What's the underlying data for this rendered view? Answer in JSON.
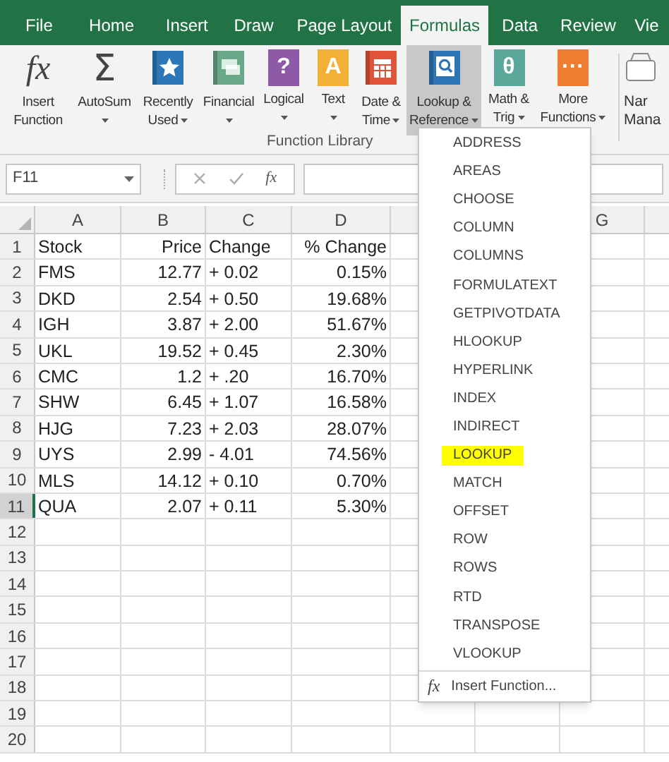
{
  "tabs": [
    {
      "label": "File",
      "selected": false
    },
    {
      "label": "Home",
      "selected": false
    },
    {
      "label": "Insert",
      "selected": false
    },
    {
      "label": "Draw",
      "selected": false
    },
    {
      "label": "Page Layout",
      "selected": false
    },
    {
      "label": "Formulas",
      "selected": true
    },
    {
      "label": "Data",
      "selected": false
    },
    {
      "label": "Review",
      "selected": false
    },
    {
      "label": "Vie",
      "selected": false
    }
  ],
  "ribbon": {
    "buttons": [
      {
        "kind": "fx",
        "glyph": "fx",
        "lines": [
          "Insert",
          "Function"
        ],
        "dropdown": false,
        "selected": false
      },
      {
        "kind": "sum",
        "glyph": "Σ",
        "lines": [
          "AutoSum"
        ],
        "dropdown": true,
        "selected": false
      },
      {
        "kind": "star",
        "color": "#2e75b6",
        "lines": [
          "Recently",
          "Used"
        ],
        "dropdown": true,
        "selected": false
      },
      {
        "kind": "bills",
        "color": "#6aa88a",
        "lines": [
          "Financial"
        ],
        "dropdown": true,
        "selected": false
      },
      {
        "kind": "letter",
        "glyph": "?",
        "color": "#8e5aa8",
        "lines": [
          "Logical"
        ],
        "dropdown": true,
        "selected": false
      },
      {
        "kind": "letter",
        "glyph": "A",
        "color": "#f2b134",
        "lines": [
          "Text"
        ],
        "dropdown": true,
        "selected": false
      },
      {
        "kind": "calendar",
        "color": "#e0533a",
        "lines": [
          "Date &",
          "Time"
        ],
        "dropdown": true,
        "selected": false
      },
      {
        "kind": "search",
        "color": "#2e75b6",
        "lines": [
          "Lookup &",
          "Reference"
        ],
        "dropdown": true,
        "selected": true
      },
      {
        "kind": "letter",
        "glyph": "θ",
        "color": "#5aa89a",
        "lines": [
          "Math &",
          "Trig"
        ],
        "dropdown": true,
        "selected": false
      },
      {
        "kind": "letter",
        "glyph": "···",
        "color": "#ed7d31",
        "lines": [
          "More",
          "Functions"
        ],
        "dropdown": true,
        "selected": false
      }
    ],
    "group_label": "Function Library",
    "cut_button": {
      "lines": [
        "Nar",
        "Mana"
      ]
    }
  },
  "formula_bar": {
    "name_box": "F11",
    "fx": "fx"
  },
  "columns": [
    "A",
    "B",
    "C",
    "D",
    "G"
  ],
  "rows": [
    {
      "number": "1",
      "selected": false,
      "cells": [
        "Stock",
        "Price",
        "Change",
        "% Change"
      ]
    },
    {
      "number": "2",
      "selected": false,
      "cells": [
        "FMS",
        "12.77",
        "+ 0.02",
        "0.15%"
      ]
    },
    {
      "number": "3",
      "selected": false,
      "cells": [
        "DKD",
        "2.54",
        "+ 0.50",
        "19.68%"
      ]
    },
    {
      "number": "4",
      "selected": false,
      "cells": [
        "IGH",
        "3.87",
        "+ 2.00",
        "51.67%"
      ]
    },
    {
      "number": "5",
      "selected": false,
      "cells": [
        "UKL",
        "19.52",
        "+ 0.45",
        "2.30%"
      ]
    },
    {
      "number": "6",
      "selected": false,
      "cells": [
        "CMC",
        "1.2",
        "+ .20",
        "16.70%"
      ]
    },
    {
      "number": "7",
      "selected": false,
      "cells": [
        "SHW",
        "6.45",
        "+ 1.07",
        "16.58%"
      ]
    },
    {
      "number": "8",
      "selected": false,
      "cells": [
        "HJG",
        "7.23",
        "+ 2.03",
        "28.07%"
      ]
    },
    {
      "number": "9",
      "selected": false,
      "cells": [
        "UYS",
        "2.99",
        "- 4.01",
        "74.56%"
      ]
    },
    {
      "number": "10",
      "selected": false,
      "cells": [
        "MLS",
        "14.12",
        "+ 0.10",
        "0.70%"
      ]
    },
    {
      "number": "11",
      "selected": true,
      "cells": [
        "QUA",
        "2.07",
        "+ 0.11",
        "5.30%"
      ]
    },
    {
      "number": "12",
      "selected": false,
      "cells": []
    },
    {
      "number": "13",
      "selected": false,
      "cells": []
    },
    {
      "number": "14",
      "selected": false,
      "cells": []
    },
    {
      "number": "15",
      "selected": false,
      "cells": []
    },
    {
      "number": "16",
      "selected": false,
      "cells": []
    },
    {
      "number": "17",
      "selected": false,
      "cells": []
    },
    {
      "number": "18",
      "selected": false,
      "cells": []
    },
    {
      "number": "19",
      "selected": false,
      "cells": []
    },
    {
      "number": "20",
      "selected": false,
      "cells": []
    }
  ],
  "menu": {
    "items": [
      {
        "label": "ADDRESS",
        "highlighted": false
      },
      {
        "label": "AREAS",
        "highlighted": false
      },
      {
        "label": "CHOOSE",
        "highlighted": false
      },
      {
        "label": "COLUMN",
        "highlighted": false
      },
      {
        "label": "COLUMNS",
        "highlighted": false
      },
      {
        "label": "FORMULATEXT",
        "highlighted": false
      },
      {
        "label": "GETPIVOTDATA",
        "highlighted": false
      },
      {
        "label": "HLOOKUP",
        "highlighted": false
      },
      {
        "label": "HYPERLINK",
        "highlighted": false
      },
      {
        "label": "INDEX",
        "highlighted": false
      },
      {
        "label": "INDIRECT",
        "highlighted": false
      },
      {
        "label": "LOOKUP",
        "highlighted": true
      },
      {
        "label": "MATCH",
        "highlighted": false
      },
      {
        "label": "OFFSET",
        "highlighted": false
      },
      {
        "label": "ROW",
        "highlighted": false
      },
      {
        "label": "ROWS",
        "highlighted": false
      },
      {
        "label": "RTD",
        "highlighted": false
      },
      {
        "label": "TRANSPOSE",
        "highlighted": false
      },
      {
        "label": "VLOOKUP",
        "highlighted": false
      }
    ],
    "footer": {
      "glyph": "fx",
      "label": "Insert Function..."
    }
  }
}
